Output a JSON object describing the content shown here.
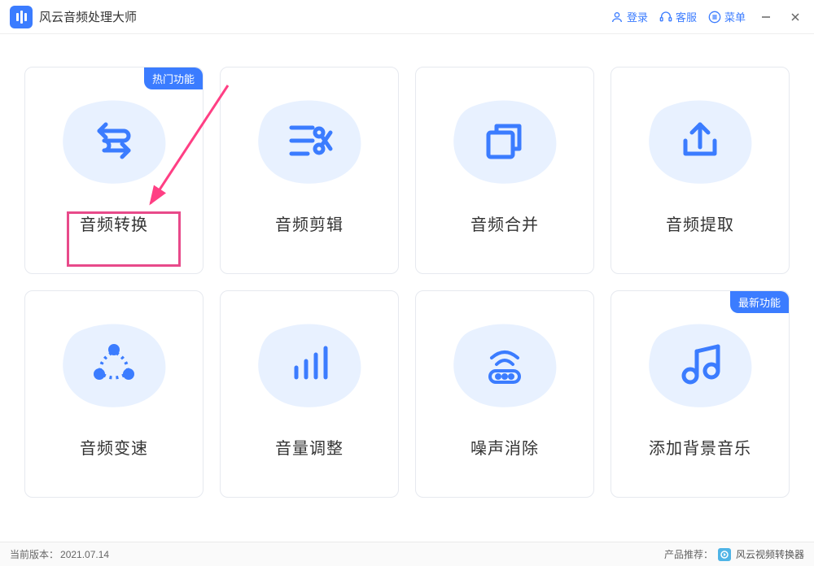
{
  "app": {
    "title": "风云音频处理大师"
  },
  "titlebar": {
    "login": "登录",
    "support": "客服",
    "menu": "菜单"
  },
  "badges": {
    "hot": "热门功能",
    "new": "最新功能"
  },
  "cards": [
    {
      "label": "音频转换"
    },
    {
      "label": "音频剪辑"
    },
    {
      "label": "音频合并"
    },
    {
      "label": "音频提取"
    },
    {
      "label": "音频变速"
    },
    {
      "label": "音量调整"
    },
    {
      "label": "噪声消除"
    },
    {
      "label": "添加背景音乐"
    }
  ],
  "footer": {
    "version_label": "当前版本：",
    "version_value": "2021.07.14",
    "recommend_label": "产品推荐：",
    "recommend_product": "风云视频转换器"
  }
}
